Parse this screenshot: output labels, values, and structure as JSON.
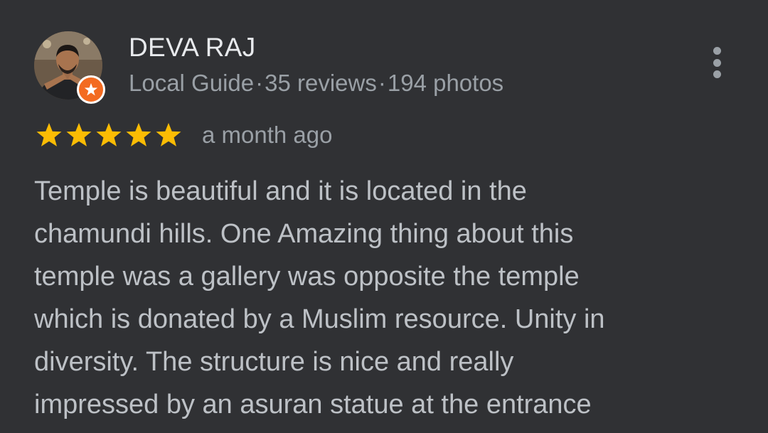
{
  "reviewer": {
    "name": "DEVA RAJ",
    "badge": "Local Guide",
    "separator": "·",
    "reviews": "35 reviews",
    "photos": "194 photos",
    "avatar_icon": "person-photo",
    "badge_icon": "local-guide-star-icon"
  },
  "menu": {
    "icon": "more-vertical-icon"
  },
  "review": {
    "rating": 5,
    "rating_max": 5,
    "date": "a month ago",
    "text_lines": [
      "Temple is beautiful and it is located in the",
      "chamundi hills. One Amazing thing about this",
      "temple was a gallery was opposite the temple",
      "which is donated by a Muslim resource. Unity in",
      "diversity. The structure is nice and really",
      "impressed by an asuran statue at the entrance"
    ]
  },
  "colors": {
    "background": "#303134",
    "name_text": "#e8eaed",
    "secondary_text": "#9aa0a6",
    "body_text": "#bdc1c6",
    "star": "#fbbc04",
    "guide_badge": "#f36b21"
  }
}
